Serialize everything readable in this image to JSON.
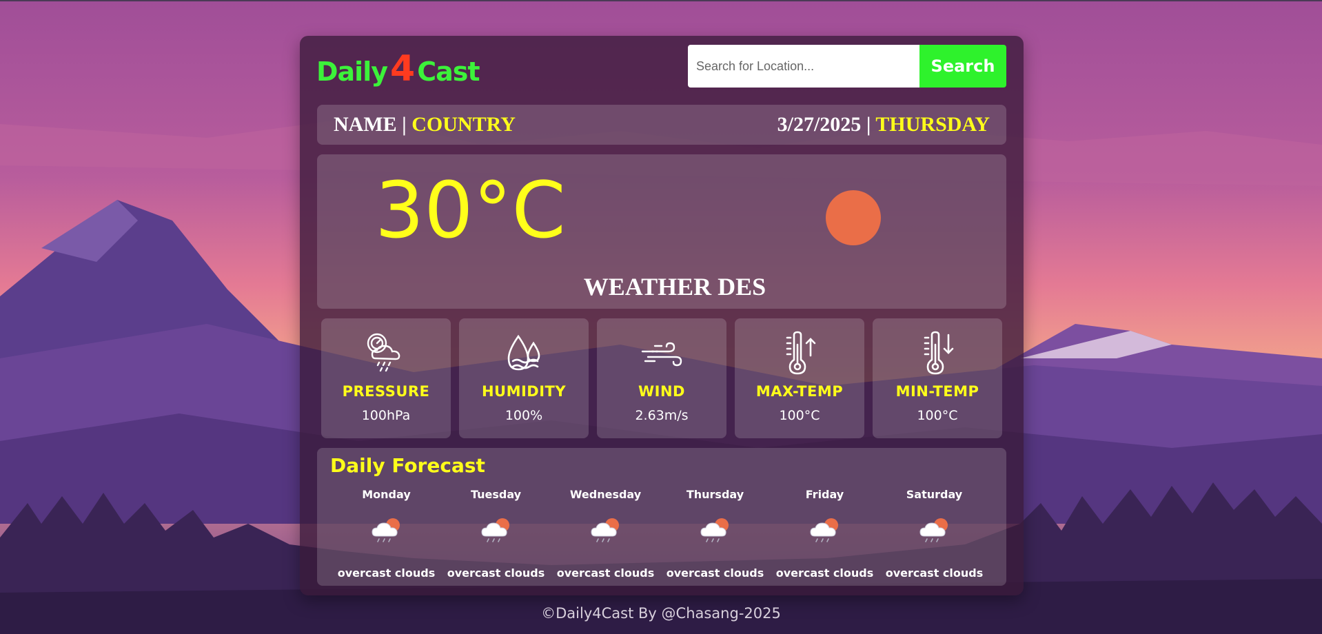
{
  "logo": {
    "part1": "Daily",
    "part2": "4",
    "part3": "Cast"
  },
  "search": {
    "placeholder": "Search for Location...",
    "button_label": "Search"
  },
  "location": {
    "name": "NAME",
    "separator": "|",
    "country": "COUNTRY",
    "date": "3/27/2025",
    "date_separator": "|",
    "weekday": "THURSDAY"
  },
  "current": {
    "temperature": "30°C",
    "description": "WEATHER DES",
    "icon": "sun-icon"
  },
  "stats": [
    {
      "label": "PRESSURE",
      "value": "100hPa",
      "icon": "pressure-icon"
    },
    {
      "label": "HUMIDITY",
      "value": "100%",
      "icon": "humidity-icon"
    },
    {
      "label": "WIND",
      "value": "2.63m/s",
      "icon": "wind-icon"
    },
    {
      "label": "MAX-TEMP",
      "value": "100°C",
      "icon": "max-temp-icon"
    },
    {
      "label": "MIN-TEMP",
      "value": "100°C",
      "icon": "min-temp-icon"
    }
  ],
  "forecast": {
    "title": "Daily Forecast",
    "days": [
      {
        "day": "Monday",
        "condition": "overcast clouds",
        "icon": "cloud-rain-sun-icon"
      },
      {
        "day": "Tuesday",
        "condition": "overcast clouds",
        "icon": "cloud-rain-sun-icon"
      },
      {
        "day": "Wednesday",
        "condition": "overcast clouds",
        "icon": "cloud-rain-sun-icon"
      },
      {
        "day": "Thursday",
        "condition": "overcast clouds",
        "icon": "cloud-rain-sun-icon"
      },
      {
        "day": "Friday",
        "condition": "overcast clouds",
        "icon": "cloud-rain-sun-icon"
      },
      {
        "day": "Saturday",
        "condition": "overcast clouds",
        "icon": "cloud-rain-sun-icon"
      }
    ]
  },
  "footer": {
    "text": "©Daily4Cast By @Chasang-2025"
  },
  "colors": {
    "accent_yellow": "#ffff1a",
    "logo_green": "#3cf23a",
    "logo_red": "#ff3b1f",
    "search_button": "#2ef22c",
    "sun": "#ea6e48"
  }
}
